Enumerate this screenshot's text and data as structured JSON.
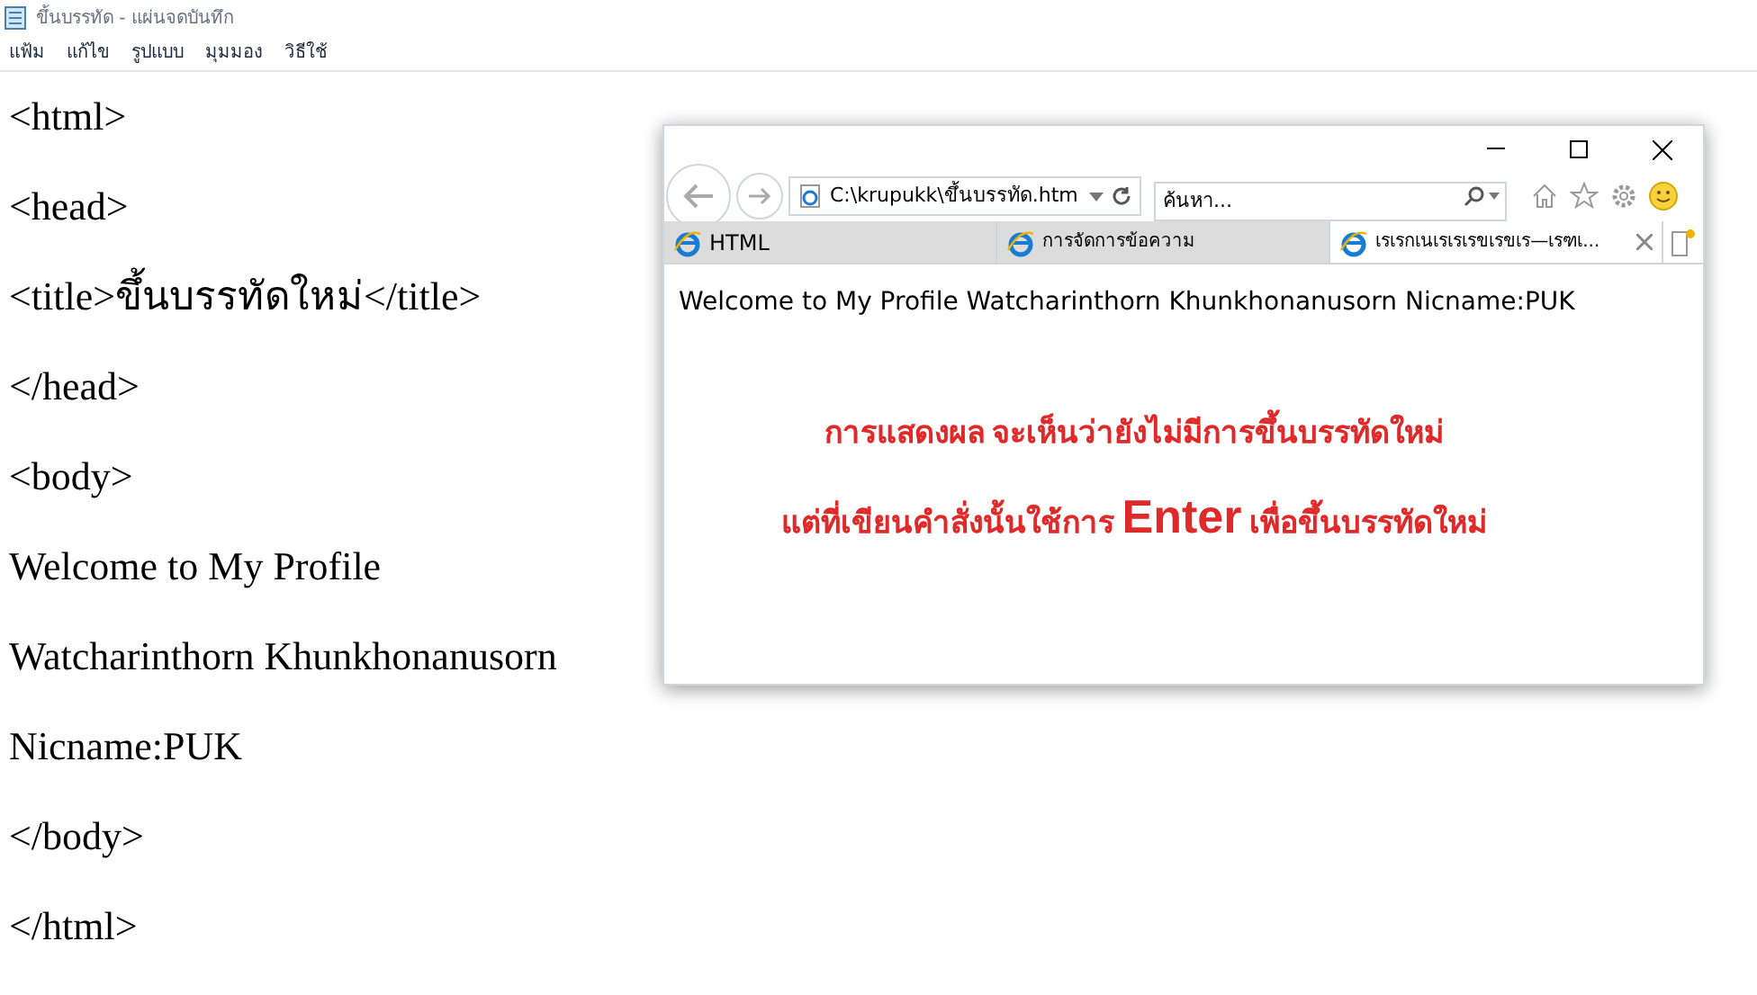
{
  "notepad": {
    "title": "ขึ้นบรรทัด - แผ่นจดบันทึก",
    "menu": [
      "แฟ้ม",
      "แก้ไข",
      "รูปแบบ",
      "มุมมอง",
      "วิธีใช้"
    ],
    "lines": [
      "<html>",
      "<head>",
      "<title>ขึ้นบรรทัดใหม่</title>",
      "</head>",
      "<body>",
      "Welcome to My Profile",
      "Watcharinthorn Khunkhonanusorn",
      "Nicname:PUK",
      "</body>",
      "</html>"
    ]
  },
  "browser": {
    "address": "C:\\krupukk\\ขึ้นบรรทัด.htm",
    "search": {
      "placeholder": "ค้นหา..."
    },
    "tabs": [
      {
        "label": "HTML",
        "selected": false
      },
      {
        "label": "การจัดการข้อความ",
        "selected": false
      },
      {
        "label": "เรเรกเนเรเรเรขเรขเร—เรฑเ...",
        "selected": true
      }
    ],
    "content": "Welcome to My Profile Watcharinthorn Khunkhonanusorn Nicname:PUK"
  },
  "notes": [
    "การแสดงผล จะเห็นว่ายังไม่มีการขึ้นบรรทัดใหม่",
    "แต่ที่เขียนคำสั่งนั้นใช้การ **Enter** เพื่อขึ้นบรรทัดใหม่"
  ]
}
